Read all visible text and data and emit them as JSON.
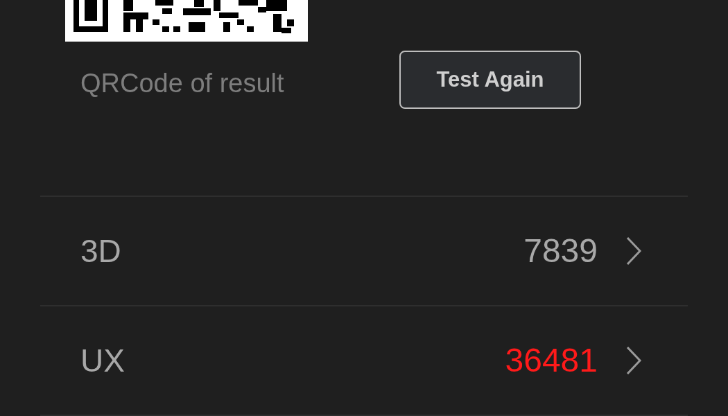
{
  "qr_caption": "QRCode of result",
  "test_again_button": "Test Again",
  "rows": [
    {
      "label": "3D",
      "value": "7839",
      "highlight": false
    },
    {
      "label": "UX",
      "value": "36481",
      "highlight": true
    }
  ]
}
